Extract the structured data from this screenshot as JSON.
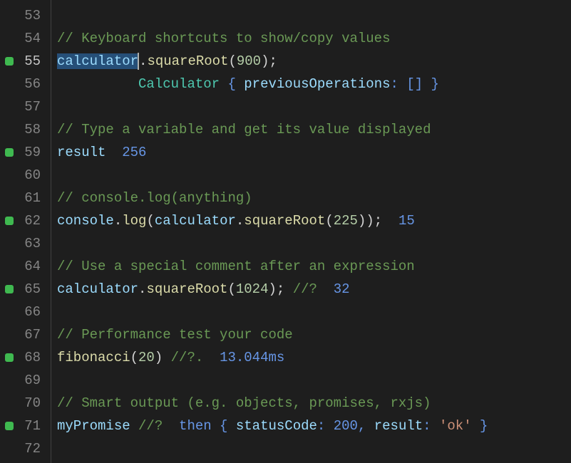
{
  "lines": [
    {
      "num": "53",
      "marker": false,
      "tokens": []
    },
    {
      "num": "54",
      "marker": false,
      "tokens": [
        {
          "cls": "tok-comment",
          "text": "// Keyboard shortcuts to show/copy values"
        }
      ]
    },
    {
      "num": "55",
      "marker": true,
      "active": true,
      "tokens": [
        {
          "cls": "tok-ident selected",
          "text": "calculator"
        },
        {
          "cls": "cursor",
          "text": ""
        },
        {
          "cls": "tok-punct",
          "text": "."
        },
        {
          "cls": "tok-method",
          "text": "squareRoot"
        },
        {
          "cls": "tok-punct",
          "text": "("
        },
        {
          "cls": "tok-number",
          "text": "900"
        },
        {
          "cls": "tok-punct",
          "text": ");"
        }
      ]
    },
    {
      "num": "56",
      "marker": false,
      "tokens": [
        {
          "cls": "",
          "text": "          "
        },
        {
          "cls": "tok-class",
          "text": "Calculator"
        },
        {
          "cls": "tok-output",
          "text": " { "
        },
        {
          "cls": "tok-ident",
          "text": "previousOperations"
        },
        {
          "cls": "tok-output",
          "text": ": [] }"
        }
      ]
    },
    {
      "num": "57",
      "marker": false,
      "tokens": []
    },
    {
      "num": "58",
      "marker": false,
      "tokens": [
        {
          "cls": "tok-comment",
          "text": "// Type a variable and get its value displayed"
        }
      ]
    },
    {
      "num": "59",
      "marker": true,
      "tokens": [
        {
          "cls": "tok-ident",
          "text": "result"
        },
        {
          "cls": "",
          "text": "  "
        },
        {
          "cls": "tok-output",
          "text": "256"
        }
      ]
    },
    {
      "num": "60",
      "marker": false,
      "tokens": []
    },
    {
      "num": "61",
      "marker": false,
      "tokens": [
        {
          "cls": "tok-comment",
          "text": "// console.log(anything)"
        }
      ]
    },
    {
      "num": "62",
      "marker": true,
      "tokens": [
        {
          "cls": "tok-ident",
          "text": "console"
        },
        {
          "cls": "tok-punct",
          "text": "."
        },
        {
          "cls": "tok-method",
          "text": "log"
        },
        {
          "cls": "tok-punct",
          "text": "("
        },
        {
          "cls": "tok-ident",
          "text": "calculator"
        },
        {
          "cls": "tok-punct",
          "text": "."
        },
        {
          "cls": "tok-method",
          "text": "squareRoot"
        },
        {
          "cls": "tok-punct",
          "text": "("
        },
        {
          "cls": "tok-number",
          "text": "225"
        },
        {
          "cls": "tok-punct",
          "text": "));  "
        },
        {
          "cls": "tok-output",
          "text": "15"
        }
      ]
    },
    {
      "num": "63",
      "marker": false,
      "tokens": []
    },
    {
      "num": "64",
      "marker": false,
      "tokens": [
        {
          "cls": "tok-comment",
          "text": "// Use a special comment after an expression"
        }
      ]
    },
    {
      "num": "65",
      "marker": true,
      "tokens": [
        {
          "cls": "tok-ident",
          "text": "calculator"
        },
        {
          "cls": "tok-punct",
          "text": "."
        },
        {
          "cls": "tok-method",
          "text": "squareRoot"
        },
        {
          "cls": "tok-punct",
          "text": "("
        },
        {
          "cls": "tok-number",
          "text": "1024"
        },
        {
          "cls": "tok-punct",
          "text": "); "
        },
        {
          "cls": "tok-comment",
          "text": "//?  "
        },
        {
          "cls": "tok-output",
          "text": "32"
        }
      ]
    },
    {
      "num": "66",
      "marker": false,
      "tokens": []
    },
    {
      "num": "67",
      "marker": false,
      "tokens": [
        {
          "cls": "tok-comment",
          "text": "// Performance test your code"
        }
      ]
    },
    {
      "num": "68",
      "marker": true,
      "tokens": [
        {
          "cls": "tok-method",
          "text": "fibonacci"
        },
        {
          "cls": "tok-punct",
          "text": "("
        },
        {
          "cls": "tok-number",
          "text": "20"
        },
        {
          "cls": "tok-punct",
          "text": ") "
        },
        {
          "cls": "tok-comment",
          "text": "//?.  "
        },
        {
          "cls": "tok-output",
          "text": "13.044ms"
        }
      ]
    },
    {
      "num": "69",
      "marker": false,
      "tokens": []
    },
    {
      "num": "70",
      "marker": false,
      "tokens": [
        {
          "cls": "tok-comment",
          "text": "// Smart output (e.g. objects, promises, rxjs)"
        }
      ]
    },
    {
      "num": "71",
      "marker": true,
      "tokens": [
        {
          "cls": "tok-ident",
          "text": "myPromise"
        },
        {
          "cls": "tok-punct",
          "text": " "
        },
        {
          "cls": "tok-comment",
          "text": "//?  "
        },
        {
          "cls": "tok-output",
          "text": "then { "
        },
        {
          "cls": "tok-ident",
          "text": "statusCode"
        },
        {
          "cls": "tok-output",
          "text": ": "
        },
        {
          "cls": "tok-output",
          "text": "200"
        },
        {
          "cls": "tok-output",
          "text": ", "
        },
        {
          "cls": "tok-ident",
          "text": "result"
        },
        {
          "cls": "tok-output",
          "text": ": "
        },
        {
          "cls": "tok-string",
          "text": "'ok'"
        },
        {
          "cls": "tok-output",
          "text": " }"
        }
      ]
    },
    {
      "num": "72",
      "marker": false,
      "tokens": []
    }
  ]
}
